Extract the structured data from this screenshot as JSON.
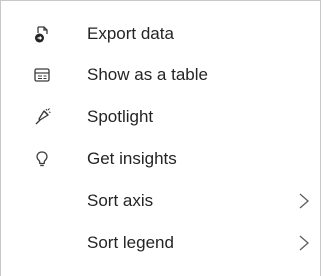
{
  "menu": {
    "items": [
      {
        "label": "Export data",
        "icon": "export-data-icon"
      },
      {
        "label": "Show as a table",
        "icon": "table-icon"
      },
      {
        "label": "Spotlight",
        "icon": "spotlight-icon"
      },
      {
        "label": "Get insights",
        "icon": "lightbulb-icon"
      },
      {
        "label": "Sort axis",
        "icon": "chevron-right-icon"
      },
      {
        "label": "Sort legend",
        "icon": "chevron-right-icon"
      }
    ]
  }
}
